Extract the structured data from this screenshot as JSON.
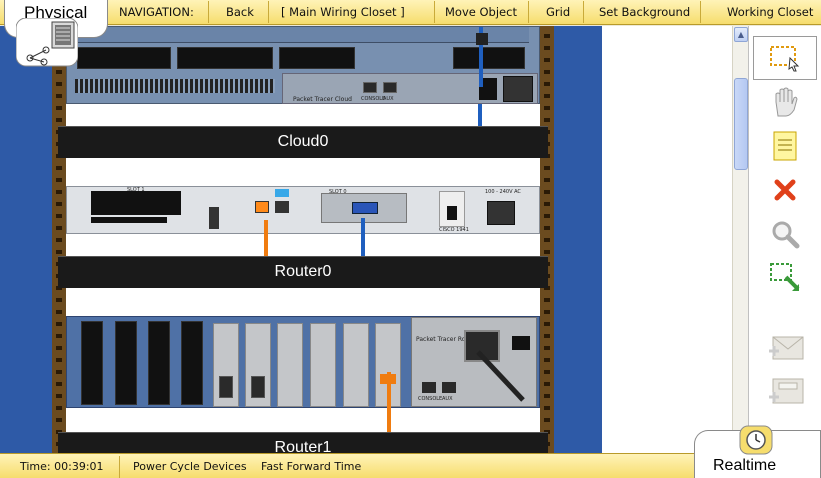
{
  "mode_tab": {
    "label": "Physical"
  },
  "navigation": {
    "title": "NAVIGATION:",
    "back": "Back",
    "location": "[ Main Wiring Closet ]",
    "move_object": "Move Object",
    "grid": "Grid",
    "set_background": "Set Background",
    "working_closet": "Working Closet"
  },
  "rack": {
    "devices": [
      {
        "name": "Cloud0",
        "panel_text": "Packet Tracer Cloud",
        "port_labels": [
          "CONSOLE",
          "AUX"
        ]
      },
      {
        "name": "Router0",
        "slot_labels": [
          "SLOT 1",
          "SLOT 0"
        ],
        "panel_text": "CISCO 1941",
        "power_text": "100 - 240V AC"
      },
      {
        "name": "Router1",
        "panel_text": "Packet Tracer Router",
        "port_labels": [
          "CONSOLE",
          "AUX"
        ]
      }
    ],
    "cable_colors": {
      "blue": "#1f5fbf",
      "orange": "#f07c10"
    }
  },
  "right_toolbar": {
    "tools": [
      {
        "name": "select-tool-icon"
      },
      {
        "name": "move-layout-hand-icon"
      },
      {
        "name": "place-note-icon"
      },
      {
        "name": "delete-icon"
      },
      {
        "name": "inspect-magnify-icon"
      },
      {
        "name": "resize-shape-icon"
      },
      {
        "name": "add-simple-pdu-icon"
      },
      {
        "name": "add-complex-pdu-icon"
      }
    ]
  },
  "status": {
    "time": "Time: 00:39:01",
    "power_cycle": "Power Cycle Devices",
    "fast_forward": "Fast Forward Time"
  },
  "realtime_tab": {
    "label": "Realtime"
  },
  "colors": {
    "bar_yellow": "#f6dd6d",
    "workspace_blue": "#2e5aa7",
    "rack_brown": "#6b4b1f"
  }
}
